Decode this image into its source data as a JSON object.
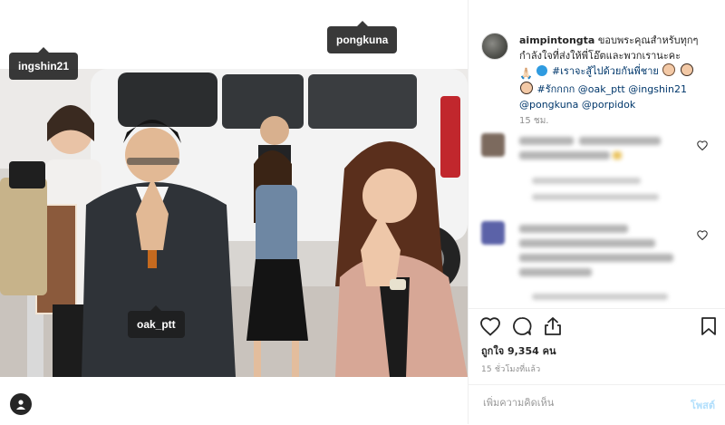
{
  "post": {
    "username": "aimpintongta",
    "caption_line1": "ขอบพระคุณสำหรับทุกๆ",
    "caption_line2": "กำลังใจที่ส่งให้พี่โอ๊ตและพวกเรานะคะ",
    "caption_hashtag1": "#เราจะสู้ไปด้วยกันพี่ชาย",
    "caption_hashtag2": "#รักกกก",
    "mention_oak": "@oak_ptt",
    "mention_ingshin": "@ingshin21",
    "mention_pongkuna": "@pongkuna",
    "mention_porpidok": "@porpidok",
    "caption_emojis": [
      "🙏🏻",
      "💙"
    ],
    "caption_time": "15 ชม."
  },
  "tags": {
    "ingshin": "ingshin21",
    "pongkuna": "pongkuna",
    "oak": "oak_ptt"
  },
  "stats": {
    "likes": "ถูกใจ 9,354 คน",
    "posted_ago": "15 ชั่วโมงที่แล้ว"
  },
  "comment_box": {
    "placeholder": "เพิ่มความคิดเห็น",
    "post_label": "โพสต์"
  },
  "icons": {
    "like": "heart-icon",
    "comment": "comment-icon",
    "share": "share-icon",
    "save": "bookmark-icon",
    "user_tags": "user-tags-icon"
  },
  "colors": {
    "link": "#00376b",
    "post_button_disabled": "#b2dffc",
    "muted": "#8e8e8e"
  }
}
